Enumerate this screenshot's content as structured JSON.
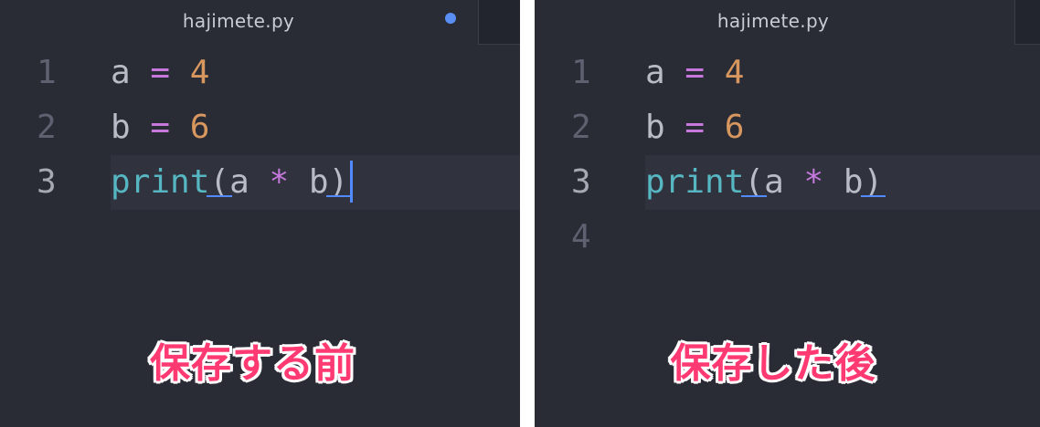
{
  "colors": {
    "editor_bg": "#292b35",
    "active_line_bg": "#30323d",
    "keyword_operator": "#c678dd",
    "number": "#d7975e",
    "function": "#56b6c2",
    "cursor": "#528bff",
    "modified_dot": "#5a8ef2",
    "caption": "#ff3a73"
  },
  "before": {
    "tab": {
      "title": "hajimete.py",
      "modified_indicator": "modified-dot-icon"
    },
    "gutter": [
      "1",
      "2",
      "3"
    ],
    "lines": [
      {
        "var": "a",
        "op": "=",
        "num": "4"
      },
      {
        "var": "b",
        "op": "=",
        "num": "6"
      },
      {
        "fn": "print",
        "open": "(",
        "a": "a",
        "op": "*",
        "b": "b",
        "close": ")"
      }
    ],
    "caption": "保存する前"
  },
  "after": {
    "tab": {
      "title": "hajimete.py"
    },
    "gutter": [
      "1",
      "2",
      "3",
      "4"
    ],
    "lines": [
      {
        "var": "a",
        "op": "=",
        "num": "4"
      },
      {
        "var": "b",
        "op": "=",
        "num": "6"
      },
      {
        "fn": "print",
        "open": "(",
        "a": "a",
        "op": "*",
        "b": "b",
        "close": ")"
      }
    ],
    "caption": "保存した後"
  }
}
